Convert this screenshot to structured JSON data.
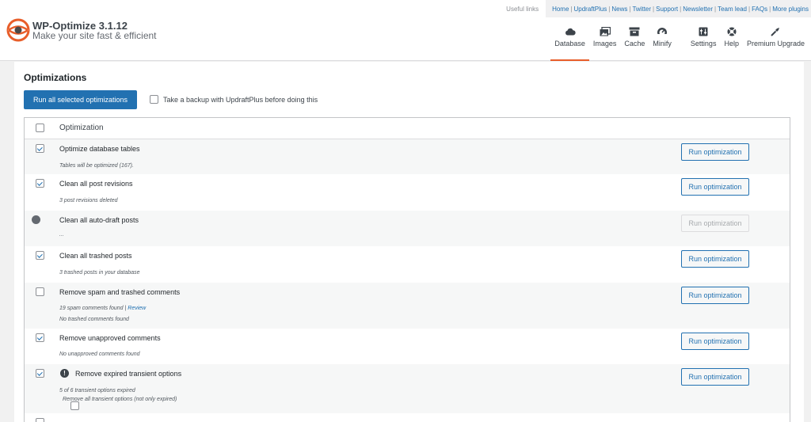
{
  "app": {
    "title": "WP-Optimize 3.1.12",
    "subtitle": "Make your site fast & efficient",
    "accent_color": "#e85e2a",
    "primary_color": "#2271b1"
  },
  "useful_links": {
    "label": "Useful links",
    "links": [
      "Home",
      "UpdraftPlus",
      "News",
      "Twitter",
      "Support",
      "Newsletter",
      "Team lead",
      "FAQs",
      "More plugins"
    ]
  },
  "tabs": [
    {
      "label": "Database",
      "icon": "cloud-icon",
      "active": true
    },
    {
      "label": "Images",
      "icon": "images-icon",
      "active": false
    },
    {
      "label": "Cache",
      "icon": "archive-icon",
      "active": false
    },
    {
      "label": "Minify",
      "icon": "dashboard-icon",
      "active": false
    },
    {
      "label": "Settings",
      "icon": "settings-icon",
      "active": false
    },
    {
      "label": "Help",
      "icon": "lifebuoy-icon",
      "active": false
    },
    {
      "label": "Premium Upgrade",
      "icon": "admin-tools-icon",
      "active": false
    }
  ],
  "main": {
    "heading": "Optimizations",
    "run_all_label": "Run all selected optimizations",
    "backup_label": "Take a backup with UpdraftPlus before doing this",
    "table_header": "Optimization",
    "button_label": "Run optimization"
  },
  "rows": [
    {
      "name": "Optimize database tables",
      "checked": true,
      "notes": [
        "Tables will be optimized (167)."
      ],
      "disabled": false
    },
    {
      "name": "Clean all post revisions",
      "checked": true,
      "notes": [
        "3 post revisions deleted"
      ],
      "disabled": false
    },
    {
      "name": "Clean all auto-draft posts",
      "checked": false,
      "indicator": "dot",
      "notes": [
        "..."
      ],
      "disabled": true
    },
    {
      "name": "Clean all trashed posts",
      "checked": true,
      "notes": [
        "3 trashed posts in your database"
      ],
      "disabled": false
    },
    {
      "name": "Remove spam and trashed comments",
      "checked": false,
      "notes": [
        "19 spam comments found |",
        "No trashed comments found"
      ],
      "review_link": "Review",
      "disabled": false
    },
    {
      "name": "Remove unapproved comments",
      "checked": true,
      "notes": [
        "No unapproved comments found"
      ],
      "disabled": false
    },
    {
      "name": "Remove expired transient options",
      "checked": true,
      "warn": "!",
      "notes": [
        "5 of 6 transient options expired"
      ],
      "sub_option": "Remove all transient options (not only expired)",
      "disabled": false
    }
  ]
}
